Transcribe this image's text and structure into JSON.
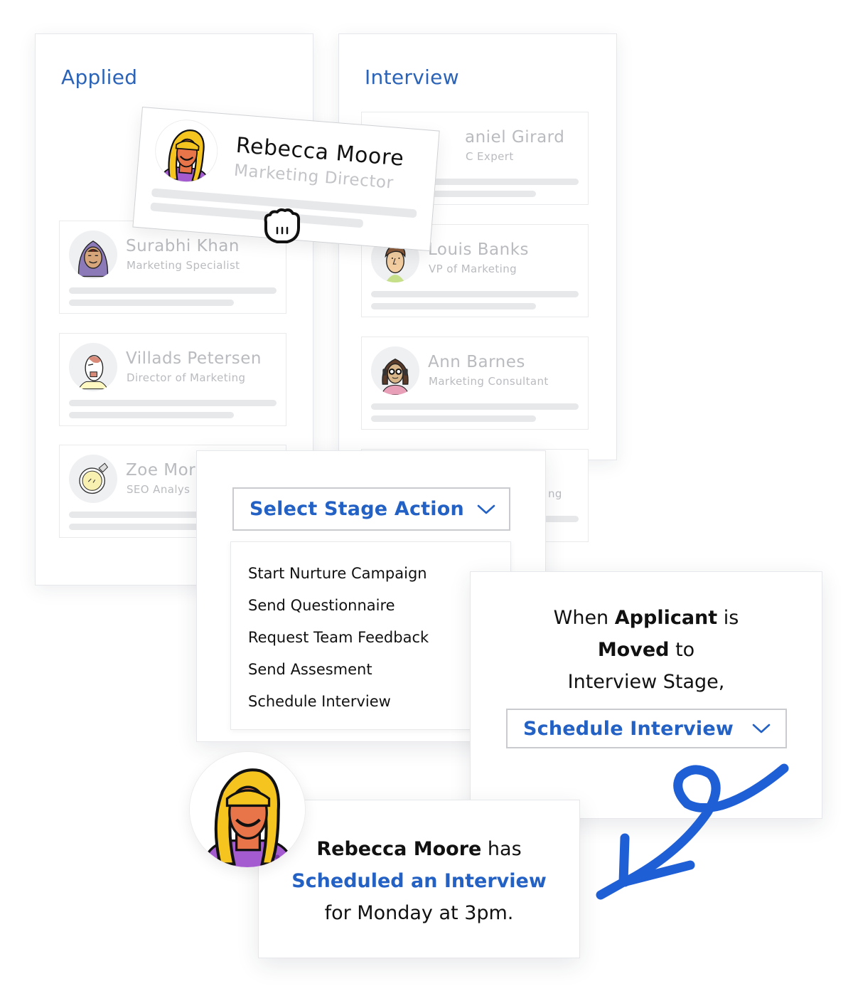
{
  "board": {
    "columns": [
      {
        "title": "Applied",
        "cards": [
          {
            "name": "Surabhi Khan",
            "title": "Marketing Specialist",
            "avatar": "woman-headscarf-avatar"
          },
          {
            "name": "Villads Petersen",
            "title": "Director of Marketing",
            "avatar": "bald-man-avatar"
          },
          {
            "name": "Zoe Mor",
            "title": "SEO Analys",
            "avatar": "astronaut-avatar"
          }
        ]
      },
      {
        "title": "Interview",
        "cards": [
          {
            "name": "aniel Girard",
            "title": "C Expert",
            "avatar": "hidden"
          },
          {
            "name": "Louis Banks",
            "title": "VP of Marketing",
            "avatar": "man-brown-hair-avatar"
          },
          {
            "name": "Ann Barnes",
            "title": "Marketing Consultant",
            "avatar": "woman-glasses-headphones-avatar"
          },
          {
            "name": "",
            "title": "ng",
            "avatar": "hidden"
          }
        ]
      }
    ]
  },
  "dragged_card": {
    "name": "Rebecca Moore",
    "title": "Marketing Director",
    "avatar": "woman-blonde-avatar",
    "cursor": "grab-hand-icon"
  },
  "stage_action": {
    "select_label": "Select Stage Action",
    "options": [
      "Start Nurture Campaign",
      "Send Questionnaire",
      "Request Team Feedback",
      "Send Assesment",
      "Schedule Interview"
    ]
  },
  "rule": {
    "part1": "When ",
    "applicant": "Applicant",
    "part2": " is",
    "moved": "Moved",
    "part3": " to",
    "part4": "Interview Stage,",
    "selected_action": "Schedule Interview"
  },
  "notification": {
    "name": "Rebecca Moore",
    "has": " has",
    "action": "Scheduled an Interview",
    "when": "for Monday at 3pm."
  },
  "colors": {
    "accent": "#2461c4",
    "column_title": "#2a63b8",
    "muted_text": "#b9bbbf",
    "squiggle": "#1f5fd6"
  }
}
